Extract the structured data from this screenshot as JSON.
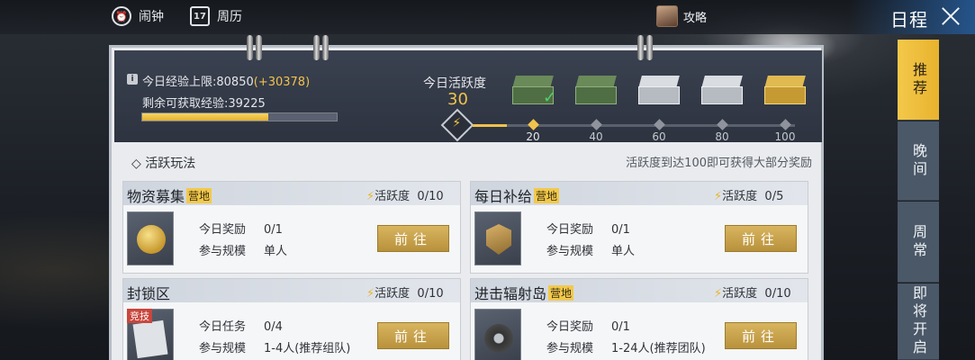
{
  "topbar": {
    "alarm_label": "闹钟",
    "calendar_label": "周历",
    "calendar_day": "17",
    "guide_label": "攻略",
    "title": "日程"
  },
  "tabs": [
    {
      "label": "推荐",
      "active": true
    },
    {
      "label": "晚间",
      "active": false
    },
    {
      "label": "周常",
      "active": false
    },
    {
      "label": "即将开启",
      "active": false
    }
  ],
  "experience": {
    "limit_label": "今日经验上限:80850",
    "limit_bonus": "(+30378)",
    "remaining_label": "剩余可获取经验:39225",
    "progress_fraction": 0.65
  },
  "activity": {
    "label": "今日活跃度",
    "value": "30",
    "max": 100,
    "milestones": [
      "20",
      "40",
      "60",
      "80",
      "100"
    ],
    "chests": [
      {
        "type": "green",
        "claimed": true
      },
      {
        "type": "green",
        "claimed": false
      },
      {
        "type": "silver",
        "claimed": false
      },
      {
        "type": "silver",
        "claimed": false
      },
      {
        "type": "gold",
        "claimed": false
      }
    ]
  },
  "section": {
    "title": "活跃玩法",
    "hint": "活跃度到达100即可获得大部分奖励"
  },
  "colors": {
    "accent": "#f1c24d",
    "tag": "#f2c94c",
    "button": "#c9a24a",
    "ribbon": "#c9463d",
    "active_tab": "#f0c03e"
  },
  "cards": [
    {
      "name": "物资募集",
      "tag": "营地",
      "activity": "活跃度",
      "activity_value": "0/10",
      "icon": "coin-icon",
      "row1_key": "今日奖励",
      "row1_val": "0/1",
      "row2_key": "参与规模",
      "row2_val": "单人",
      "button": "前往"
    },
    {
      "name": "每日补给",
      "tag": "营地",
      "activity": "活跃度",
      "activity_value": "0/5",
      "icon": "badge-icon",
      "row1_key": "今日奖励",
      "row1_val": "0/1",
      "row2_key": "参与规模",
      "row2_val": "单人",
      "button": "前往"
    },
    {
      "name": "封锁区",
      "tag": "",
      "ribbon": "竞技",
      "activity": "活跃度",
      "activity_value": "0/10",
      "icon": "document-icon",
      "row1_key": "今日任务",
      "row1_val": "0/4",
      "row2_key": "参与规模",
      "row2_val": "1-4人(推荐组队)",
      "button": "前往"
    },
    {
      "name": "进击辐射岛",
      "tag": "营地",
      "activity": "活跃度",
      "activity_value": "0/10",
      "icon": "disc-icon",
      "row1_key": "今日奖励",
      "row1_val": "0/1",
      "row2_key": "参与规模",
      "row2_val": "1-24人(推荐团队)",
      "button": "前往"
    }
  ]
}
